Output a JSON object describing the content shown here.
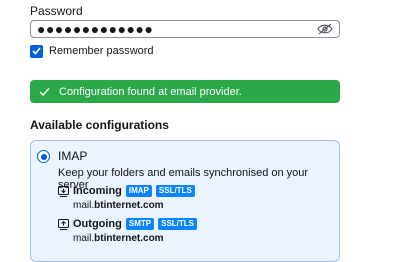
{
  "password": {
    "label": "Password",
    "masked_value": "●●●●●●●●●●●●●",
    "remember_label": "Remember password",
    "remember_checked": true
  },
  "banner": {
    "text": "Configuration found at email provider.",
    "color": "#2ba84a"
  },
  "available": {
    "heading": "Available configurations",
    "option": {
      "protocol": "IMAP",
      "description": "Keep your folders and emails synchronised on your server",
      "selected": true,
      "incoming": {
        "label": "Incoming",
        "badges": [
          "IMAP",
          "SSL/TLS"
        ],
        "host_prefix": "mail.",
        "host_bold": "btinternet.com"
      },
      "outgoing": {
        "label": "Outgoing",
        "badges": [
          "SMTP",
          "SSL/TLS"
        ],
        "host_prefix": "mail.",
        "host_bold": "btinternet.com"
      }
    }
  },
  "colors": {
    "accent": "#0061e0",
    "badge": "#0a84ff",
    "card_bg": "#eaf3fe"
  }
}
